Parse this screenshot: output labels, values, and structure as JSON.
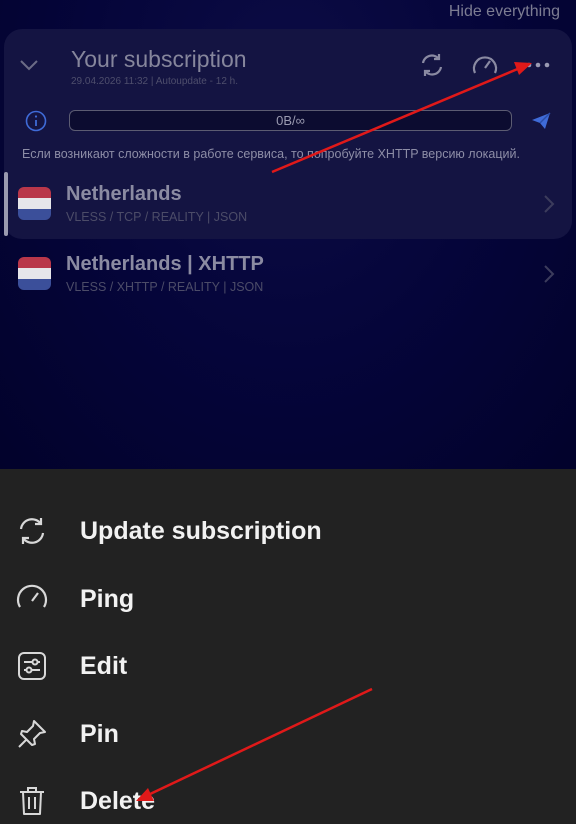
{
  "top": {
    "hide_everything": "Hide everything"
  },
  "subscription": {
    "title": "Your subscription",
    "meta": "29.04.2026 11:32 | Autoupdate - 12 h.",
    "traffic": "0B/∞",
    "notice": "Если возникают сложности в работе сервиса, то попробуйте XHTTP версию локаций.",
    "icons": [
      "chevron-down-icon",
      "refresh-icon",
      "speedometer-icon",
      "more-icon",
      "info-icon",
      "telegram-send-icon"
    ]
  },
  "servers": [
    {
      "name": "Netherlands",
      "protocol": "VLESS / TCP / REALITY | JSON",
      "selected": true
    },
    {
      "name": "Netherlands | XHTTP",
      "protocol": "VLESS / XHTTP / REALITY | JSON",
      "selected": false
    }
  ],
  "flag_colors": [
    "#c7374a",
    "#f3f3f3",
    "#3b4f9a"
  ],
  "menu": {
    "items": [
      {
        "label": "Update subscription",
        "icon": "refresh-icon"
      },
      {
        "label": "Ping",
        "icon": "speedometer-icon"
      },
      {
        "label": "Edit",
        "icon": "sliders-icon"
      },
      {
        "label": "Pin",
        "icon": "pin-icon"
      },
      {
        "label": "Delete",
        "icon": "trash-icon"
      }
    ]
  },
  "colors": {
    "accent_blue": "#3f6bd8",
    "annotation_arrow": "#e01919",
    "sheet_background": "#222222"
  }
}
